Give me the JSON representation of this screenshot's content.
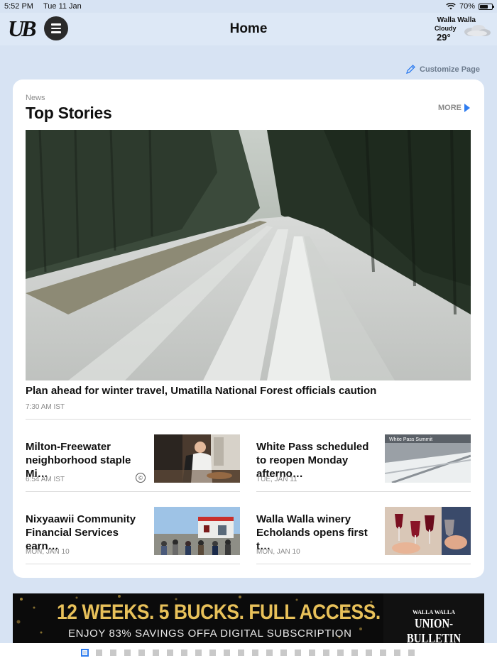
{
  "status_bar": {
    "time": "5:52 PM",
    "date": "Tue 11 Jan",
    "battery": "70%",
    "battery_level": 0.7
  },
  "nav": {
    "logo": "UB",
    "title": "Home"
  },
  "weather": {
    "city": "Walla Walla",
    "condition": "Cloudy",
    "temperature": "29°",
    "icon": "cloud-icon"
  },
  "customize": {
    "label": "Customize Page",
    "icon": "pencil-icon"
  },
  "section": {
    "label": "News",
    "title": "Top Stories",
    "more_label": "MORE"
  },
  "hero": {
    "title": "Plan ahead for winter travel, Umatilla National Forest officials caution",
    "time": "7:30 AM IST",
    "image": "snowy-forest-road-photo"
  },
  "stories": [
    {
      "title": "Milton-Freewater neighborhood staple Mi…",
      "time": "6:54 AM IST",
      "image": "chef-kitchen-photo",
      "premium_icon": "copyright-icon"
    },
    {
      "title": "White Pass scheduled to reopen Monday afterno…",
      "time": "TUE, JAN 11",
      "image": "white-pass-summit-webcam",
      "image_caption": "White Pass Summit"
    },
    {
      "title": "Nixyaawii Community Financial Services earn…",
      "time": "MON, JAN 10",
      "image": "community-building-photo"
    },
    {
      "title": "Walla Walla winery Echolands opens first t…",
      "time": "MON, JAN 10",
      "image": "wine-glasses-photo"
    }
  ],
  "ad": {
    "headline": "12 WEEKS. 5 BUCKS. FULL ACCESS.",
    "subline": "ENJOY 83% SAVINGS OFFA DIGITAL SUBSCRIPTION",
    "brand_small": "WALLA WALLA",
    "brand_big": "UNION-BULLETIN"
  },
  "pager": {
    "page_count": 24,
    "current_page": 1
  },
  "colors": {
    "accent": "#2f7df0",
    "background": "#d7e3f3",
    "card": "#ffffff",
    "muted": "#8a8a8a"
  }
}
